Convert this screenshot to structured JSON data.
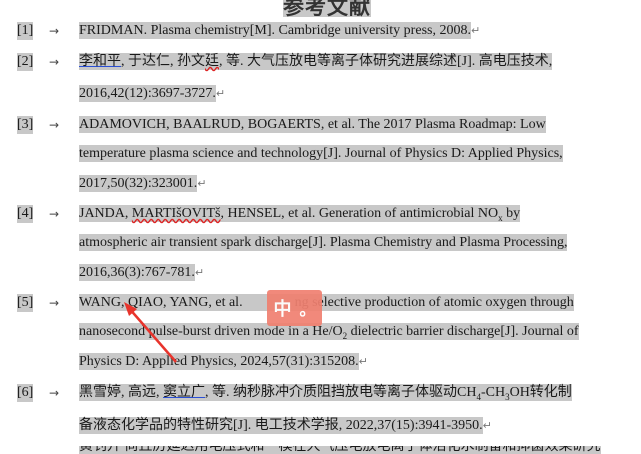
{
  "heading": "参考文献",
  "arrow_glyph": "→",
  "return_glyph": "↵",
  "ime_indicator": {
    "char": "中",
    "punct": "。"
  },
  "references": [
    {
      "num": "[1]",
      "lines": [
        "FRIDMAN. Plasma chemistry[M]. Cambridge university press, 2008."
      ]
    },
    {
      "num": "[2]",
      "lines": [
        "李和平, 于达仁, 孙文廷, 等. 大气压放电等离子体研究进展综述[J]. 高电压技术,",
        "2016,42(12):3697-3727."
      ]
    },
    {
      "num": "[3]",
      "lines": [
        "ADAMOVICH, BAALRUD, BOGAERTS, et al. The 2017 Plasma Roadmap: Low",
        "temperature plasma science and technology[J]. Journal of Physics D: Applied Physics,",
        "2017,50(32):323001."
      ]
    },
    {
      "num": "[4]",
      "lines": [
        "JANDA, MARTIŠOVITš, HENSEL, et al. Generation of antimicrobial NOx by",
        "atmospheric air transient spark discharge[J]. Plasma Chemistry and Plasma Processing,",
        "2016,36(3):767-781."
      ]
    },
    {
      "num": "[5]",
      "lines": [
        "WANG, QIAO, YANG, et al. Achieving selective production of atomic oxygen through",
        "nanosecond pulse-burst driven mode in a He/O2 dielectric barrier discharge[J]. Journal of",
        "Physics D: Applied Physics, 2024,57(31):315208."
      ]
    },
    {
      "num": "[6]",
      "lines": [
        "黑雪婷, 高远, 窦立广, 等. 纳秒脉冲介质阻挡放电等离子体驱动CH4-CH3OH转化制",
        "备液态化学品的特性研究[J]. 电工技术学报, 2022,37(15):3941-3950."
      ]
    }
  ],
  "partial_line": "黄钊升 尚丘厉延迟用电压式和一模在大气压电放电离子体活化水制备和抑菌效果研究",
  "r5_overlay_tail": "ng selective production of atomic oxygen through",
  "r1_tail": "Cambridge university press, 2008.",
  "r2_p1": "李和平",
  "r2_p2": ", 于达仁, 孙文",
  "r2_p3": "廷",
  "r2_p4": ", 等. 大气压放电等离子体研究进展综述[J]. 高电压技术,",
  "r4_p1": "JANDA, ",
  "r4_p2": "MARTIšOVITš",
  "r4_p3": ", HENSEL, et al. Generation of antimicrobial NO",
  "r4_sub": "x",
  "r4_p4": " by",
  "r5_l1a": "WANG, QIAO, YANG, et al.",
  "r5_l2a": "nanosecond pulse-burst driven mode in a He/O",
  "r5_l2sub": "2",
  "r5_l2b": " dielectric barrier discharge[J]. Journal of",
  "r6_p1": "黑雪婷, 高远, ",
  "r6_p2": "窦立广",
  "r6_p3": ", 等. 纳秒脉冲介质阻挡放电等离子体驱动CH",
  "r6_sub1": "4",
  "r6_p4": "-CH",
  "r6_sub2": "3",
  "r6_p5": "OH转化制"
}
